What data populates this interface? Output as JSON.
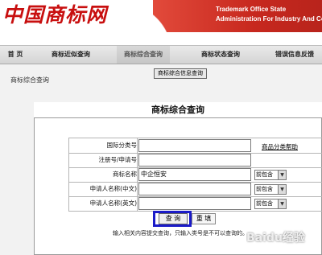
{
  "header": {
    "logo_text": "中国商标网",
    "banner_line1": "Trademark Office State",
    "banner_line2": "Administration For Industry And Commerce"
  },
  "nav": {
    "home": "首  页",
    "similar": "商标近似查询",
    "combined": "商标综合查询",
    "status": "商标状态查询",
    "errors": "错误信息反馈"
  },
  "page": {
    "label": "商标综合查询",
    "info_query_button": "商标综合信息查询"
  },
  "form": {
    "title": "商标综合查询",
    "fields": [
      {
        "label": "国际分类号",
        "value": ""
      },
      {
        "label": "注册号/申请号",
        "value": ""
      },
      {
        "label": "商标名称",
        "value": "中企恒安",
        "select": "前包含"
      },
      {
        "label": "申请人名称(中文)",
        "value": "",
        "select": "前包含"
      },
      {
        "label": "申请人名称(英文)",
        "value": "",
        "select": "前包含"
      }
    ],
    "help_link": "商品分类帮助",
    "query_button": "查 询",
    "reset_button": "重 填",
    "hint": "输入相关内容提交查询，只输入类号是不可以查询的。"
  },
  "watermark": "Baidu经验",
  "colors": {
    "logo_red": "#c80f0f",
    "banner_red": "#c7281e",
    "highlight_blue": "#1b1bc8"
  }
}
